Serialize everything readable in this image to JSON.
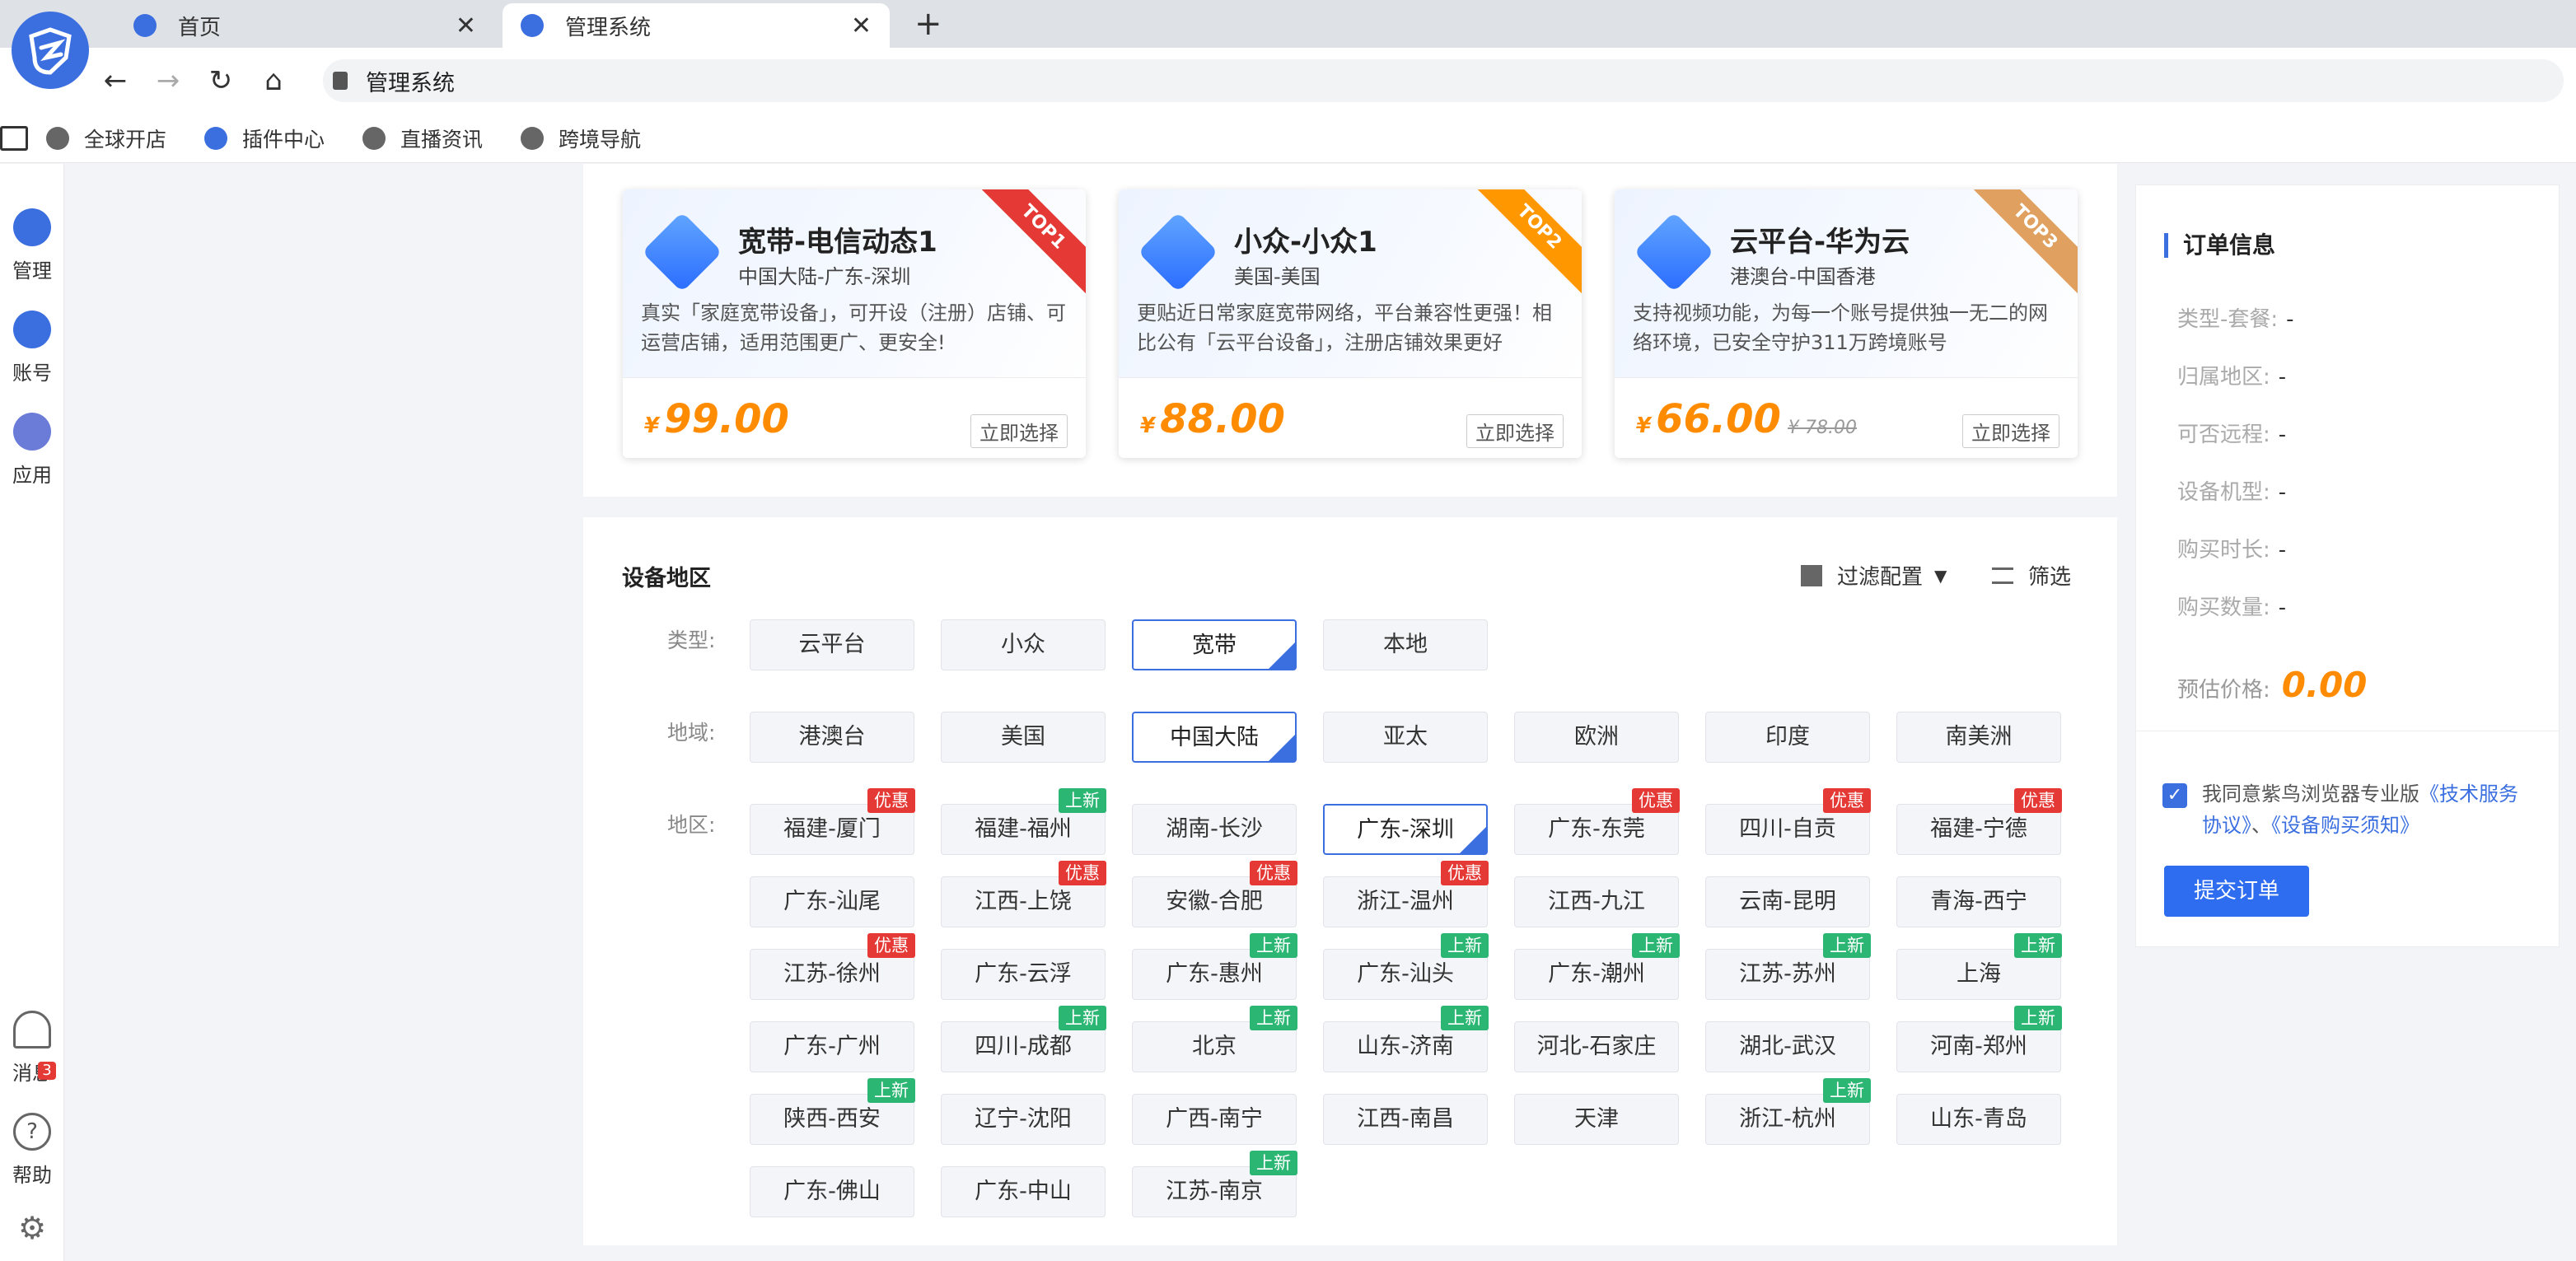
{
  "browser": {
    "tabs": [
      {
        "label": "首页"
      },
      {
        "label": "管理系统"
      }
    ],
    "new_tab": "+",
    "close": "✕",
    "nav": {
      "back": "←",
      "forward": "→",
      "reload": "↻",
      "home": "⌂"
    },
    "url": "管理系统",
    "bookmarks": [
      "全球开店",
      "插件中心",
      "直播资讯",
      "跨境导航"
    ]
  },
  "sidebar": {
    "items": [
      {
        "label": "管理"
      },
      {
        "label": "账号"
      },
      {
        "label": "应用"
      }
    ],
    "bottom": [
      {
        "label": "消息",
        "badge": "3"
      },
      {
        "label": "帮助",
        "icon": "?"
      },
      {
        "label": "",
        "icon": "⚙"
      }
    ]
  },
  "featured": [
    {
      "name": "宽带-电信动态1",
      "region": "中国大陆-广东-深圳",
      "desc": "真实「家庭宽带设备」，可开设（注册）店铺、可运营店铺，适用范围更广、更安全!",
      "currency": "¥",
      "price": "99.00",
      "orig": "",
      "action": "立即选择",
      "ribbon": "TOP1",
      "ribbon_color": "#e53935"
    },
    {
      "name": "小众-小众1",
      "region": "美国-美国",
      "desc": "更贴近日常家庭宽带网络，平台兼容性更强！相比公有「云平台设备」，注册店铺效果更好",
      "currency": "¥",
      "price": "88.00",
      "orig": "",
      "action": "立即选择",
      "ribbon": "TOP2",
      "ribbon_color": "#ff9800"
    },
    {
      "name": "云平台-华为云",
      "region": "港澳台-中国香港",
      "desc": "支持视频功能，为每一个账号提供独一无二的网络环境，已安全守护311万跨境账号",
      "currency": "¥",
      "price": "66.00",
      "orig": "¥ 78.00",
      "action": "立即选择",
      "ribbon": "TOP3",
      "ribbon_color": "#e0a060"
    }
  ],
  "filters": {
    "title": "设备地区",
    "config_label": "过滤配置",
    "filter_label": "筛选",
    "type_label": "类型:",
    "types": [
      "云平台",
      "小众",
      "宽带",
      "本地"
    ],
    "type_selected": "宽带",
    "area_label": "地域:",
    "areas": [
      "港澳台",
      "美国",
      "中国大陆",
      "亚太",
      "欧洲",
      "印度",
      "南美洲"
    ],
    "area_selected": "中国大陆",
    "region_label": "地区:",
    "regions": [
      {
        "name": "福建-厦门",
        "tag": "优惠"
      },
      {
        "name": "福建-福州",
        "tag": "上新"
      },
      {
        "name": "湖南-长沙",
        "tag": ""
      },
      {
        "name": "广东-深圳",
        "tag": "",
        "selected": true
      },
      {
        "name": "广东-东莞",
        "tag": "优惠"
      },
      {
        "name": "四川-自贡",
        "tag": "优惠"
      },
      {
        "name": "福建-宁德",
        "tag": "优惠"
      },
      {
        "name": "广东-汕尾",
        "tag": ""
      },
      {
        "name": "江西-上饶",
        "tag": "优惠"
      },
      {
        "name": "安徽-合肥",
        "tag": "优惠"
      },
      {
        "name": "浙江-温州",
        "tag": "优惠"
      },
      {
        "name": "江西-九江",
        "tag": ""
      },
      {
        "name": "云南-昆明",
        "tag": ""
      },
      {
        "name": "青海-西宁",
        "tag": ""
      },
      {
        "name": "江苏-徐州",
        "tag": "优惠"
      },
      {
        "name": "广东-云浮",
        "tag": ""
      },
      {
        "name": "广东-惠州",
        "tag": "上新"
      },
      {
        "name": "广东-汕头",
        "tag": "上新"
      },
      {
        "name": "广东-潮州",
        "tag": "上新"
      },
      {
        "name": "江苏-苏州",
        "tag": "上新"
      },
      {
        "name": "上海",
        "tag": "上新"
      },
      {
        "name": "广东-广州",
        "tag": ""
      },
      {
        "name": "四川-成都",
        "tag": "上新"
      },
      {
        "name": "北京",
        "tag": "上新"
      },
      {
        "name": "山东-济南",
        "tag": "上新"
      },
      {
        "name": "河北-石家庄",
        "tag": ""
      },
      {
        "name": "湖北-武汉",
        "tag": ""
      },
      {
        "name": "河南-郑州",
        "tag": "上新"
      },
      {
        "name": "陕西-西安",
        "tag": "上新"
      },
      {
        "name": "辽宁-沈阳",
        "tag": ""
      },
      {
        "name": "广西-南宁",
        "tag": ""
      },
      {
        "name": "江西-南昌",
        "tag": ""
      },
      {
        "name": "天津",
        "tag": ""
      },
      {
        "name": "浙江-杭州",
        "tag": "上新"
      },
      {
        "name": "山东-青岛",
        "tag": ""
      },
      {
        "name": "广东-佛山",
        "tag": ""
      },
      {
        "name": "广东-中山",
        "tag": ""
      },
      {
        "name": "江苏-南京",
        "tag": "上新"
      }
    ]
  },
  "order": {
    "title": "订单信息",
    "rows": [
      {
        "label": "类型-套餐:",
        "value": "-"
      },
      {
        "label": "归属地区:",
        "value": "-"
      },
      {
        "label": "可否远程:",
        "value": "-"
      },
      {
        "label": "设备机型:",
        "value": "-"
      },
      {
        "label": "购买时长:",
        "value": "-"
      },
      {
        "label": "购买数量:",
        "value": "-"
      }
    ],
    "estimate_label": "预估价格:",
    "estimate_value": "0.00",
    "agree_prefix": "我同意紫鸟浏览器专业版",
    "agree_link1": "《技术服务协议》",
    "agree_sep": "、",
    "agree_link2": "《设备购买须知》",
    "submit": "提交订单"
  },
  "colors": {
    "accent": "#3b6fe0",
    "price": "#ff8c00",
    "hot": "#e53935",
    "new": "#2bb673"
  }
}
